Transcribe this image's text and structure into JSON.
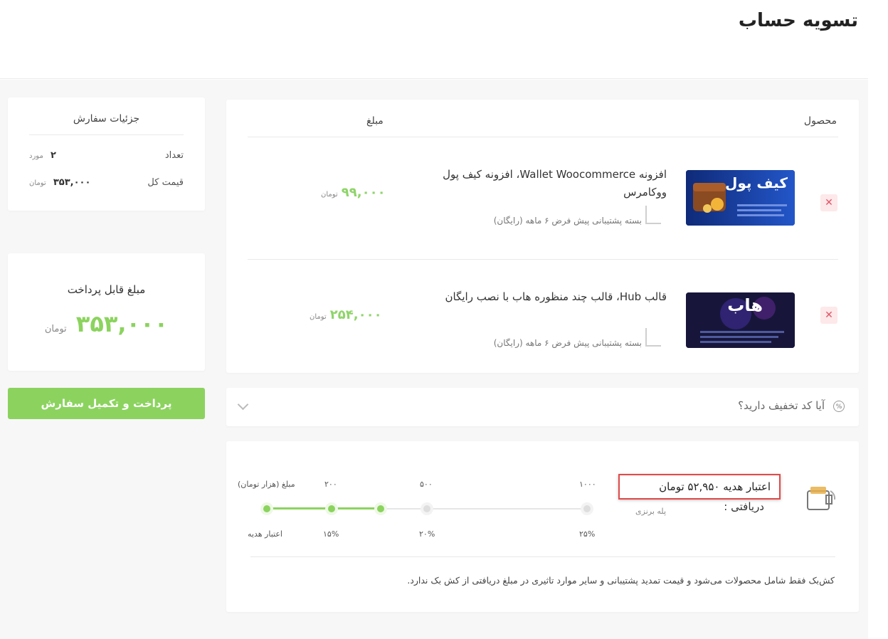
{
  "page": {
    "title": "تسویه حساب"
  },
  "cart": {
    "header": {
      "product": "محصول",
      "amount": "مبلغ"
    },
    "items": [
      {
        "title": "افزونه Wallet Woocommerce، افزونه کیف پول ووکامرس",
        "subtitle": "بسته پشتیبانی پیش فرض ۶ ماهه (رایگان)",
        "price": "۹۹,۰۰۰",
        "currency": "تومان",
        "thumb_label": "کیف پول",
        "thumb_color": "#1b3f9e",
        "remove_icon": "close-icon"
      },
      {
        "title": "قالب Hub، قالب چند منظوره هاب با نصب رایگان",
        "subtitle": "بسته پشتیبانی پیش فرض ۶ ماهه (رایگان)",
        "price": "۲۵۴,۰۰۰",
        "currency": "تومان",
        "thumb_label": "هاب",
        "thumb_color": "#1c1a3d",
        "remove_icon": "close-icon"
      }
    ]
  },
  "discount": {
    "label": "آیا کد تخفیف دارید؟",
    "icon": "percent-icon",
    "toggle_icon": "chevron-down-icon"
  },
  "cashback": {
    "title": "اعتبار هدیه ۵۲,۹۵۰ تومان",
    "title_line2": "دریافتی :",
    "tier": "پله برنزی",
    "icon": "wallet-icon",
    "scale_label": "مبلغ (هزار تومان)",
    "credit_label": "اعتبار هدیه",
    "steps": [
      {
        "amount": "۲۰۰",
        "percent": "۱۵%"
      },
      {
        "amount": "۵۰۰",
        "percent": "۲۰%"
      },
      {
        "amount": "۱۰۰۰",
        "percent": "۲۵%"
      }
    ],
    "note": "کش‌بک فقط شامل محصولات می‌شود و قیمت تمدید پشتیبانی و سایر موارد تاثیری در مبلغ دریافتی از کش بک ندارد."
  },
  "summary": {
    "title": "جزئیات سفارش",
    "count_label": "تعداد",
    "count_value": "۲",
    "count_unit": "مورد",
    "total_label": "قیمت کل",
    "total_value": "۳۵۳,۰۰۰",
    "total_unit": "تومان"
  },
  "payable": {
    "label": "مبلغ قابل پرداخت",
    "amount": "۳۵۳,۰۰۰",
    "unit": "تومان"
  },
  "checkout": {
    "button_label": "پرداخت و تکمیل سفارش"
  },
  "colors": {
    "accent": "#8bd35e",
    "price": "#8fd46a",
    "remove_bg": "#fde8ea",
    "remove_fg": "#e05565",
    "highlight_border": "#e14a4a"
  }
}
